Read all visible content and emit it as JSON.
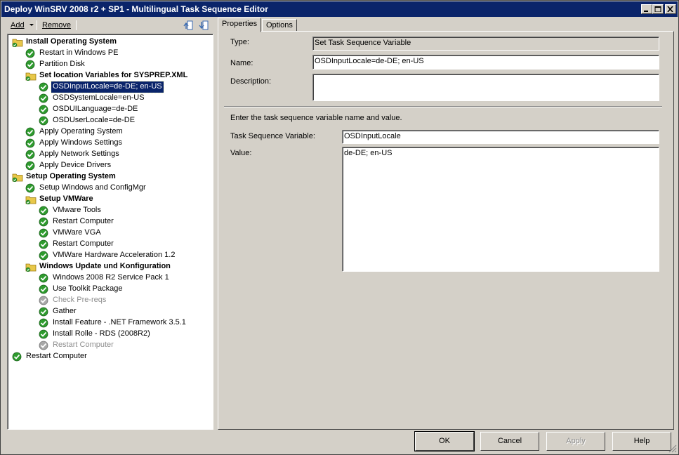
{
  "window": {
    "title": "Deploy WinSRV 2008 r2 + SP1 - Multilingual Task Sequence Editor"
  },
  "toolbar": {
    "add_label": "Add",
    "remove_label": "Remove"
  },
  "tree": [
    {
      "label": "Install Operating System",
      "level": 0,
      "kind": "group"
    },
    {
      "label": "Restart in Windows PE",
      "level": 1,
      "kind": "step"
    },
    {
      "label": "Partition Disk",
      "level": 1,
      "kind": "step"
    },
    {
      "label": "Set location Variables for SYSPREP.XML",
      "level": 1,
      "kind": "group"
    },
    {
      "label": "OSDInputLocale=de-DE; en-US",
      "level": 2,
      "kind": "step",
      "selected": true
    },
    {
      "label": "OSDSystemLocale=en-US",
      "level": 2,
      "kind": "step"
    },
    {
      "label": "OSDUILanguage=de-DE",
      "level": 2,
      "kind": "step"
    },
    {
      "label": "OSDUserLocale=de-DE",
      "level": 2,
      "kind": "step"
    },
    {
      "label": "Apply Operating System",
      "level": 1,
      "kind": "step"
    },
    {
      "label": "Apply Windows Settings",
      "level": 1,
      "kind": "step"
    },
    {
      "label": "Apply Network Settings",
      "level": 1,
      "kind": "step"
    },
    {
      "label": "Apply Device Drivers",
      "level": 1,
      "kind": "step"
    },
    {
      "label": "Setup Operating System",
      "level": 0,
      "kind": "group"
    },
    {
      "label": "Setup Windows and ConfigMgr",
      "level": 1,
      "kind": "step"
    },
    {
      "label": "Setup VMWare",
      "level": 1,
      "kind": "group"
    },
    {
      "label": "VMware Tools",
      "level": 2,
      "kind": "step"
    },
    {
      "label": "Restart Computer",
      "level": 2,
      "kind": "step"
    },
    {
      "label": "VMWare VGA",
      "level": 2,
      "kind": "step"
    },
    {
      "label": "Restart Computer",
      "level": 2,
      "kind": "step"
    },
    {
      "label": "VMWare Hardware Acceleration 1.2",
      "level": 2,
      "kind": "step"
    },
    {
      "label": "Windows Update und Konfiguration",
      "level": 1,
      "kind": "group"
    },
    {
      "label": "Windows 2008 R2 Service Pack 1",
      "level": 2,
      "kind": "step"
    },
    {
      "label": "Use Toolkit Package",
      "level": 2,
      "kind": "step"
    },
    {
      "label": "Check Pre-reqs",
      "level": 2,
      "kind": "step",
      "disabled": true
    },
    {
      "label": "Gather",
      "level": 2,
      "kind": "step"
    },
    {
      "label": "Install Feature - .NET Framework 3.5.1",
      "level": 2,
      "kind": "step"
    },
    {
      "label": "Install Rolle - RDS (2008R2)",
      "level": 2,
      "kind": "step"
    },
    {
      "label": "Restart Computer",
      "level": 2,
      "kind": "step",
      "disabled": true
    },
    {
      "label": "Restart Computer",
      "level": 0,
      "kind": "step"
    }
  ],
  "tabs": [
    {
      "label": "Properties"
    },
    {
      "label": "Options"
    }
  ],
  "properties": {
    "type_label": "Type:",
    "type_value": "Set Task Sequence Variable",
    "name_label": "Name:",
    "name_value": "OSDInputLocale=de-DE; en-US",
    "description_label": "Description:",
    "description_value": "",
    "instruction": "Enter the task sequence variable name and value.",
    "variable_label": "Task Sequence Variable:",
    "variable_value": "OSDInputLocale",
    "value_label": "Value:",
    "value_value": "de-DE; en-US"
  },
  "buttons": {
    "ok": "OK",
    "cancel": "Cancel",
    "apply": "Apply",
    "help": "Help"
  },
  "colors": {
    "titlebar": "#0a246a",
    "selection": "#0a246a",
    "check_green": "#2e9b2e",
    "folder_yellow": "#e8c84a"
  }
}
